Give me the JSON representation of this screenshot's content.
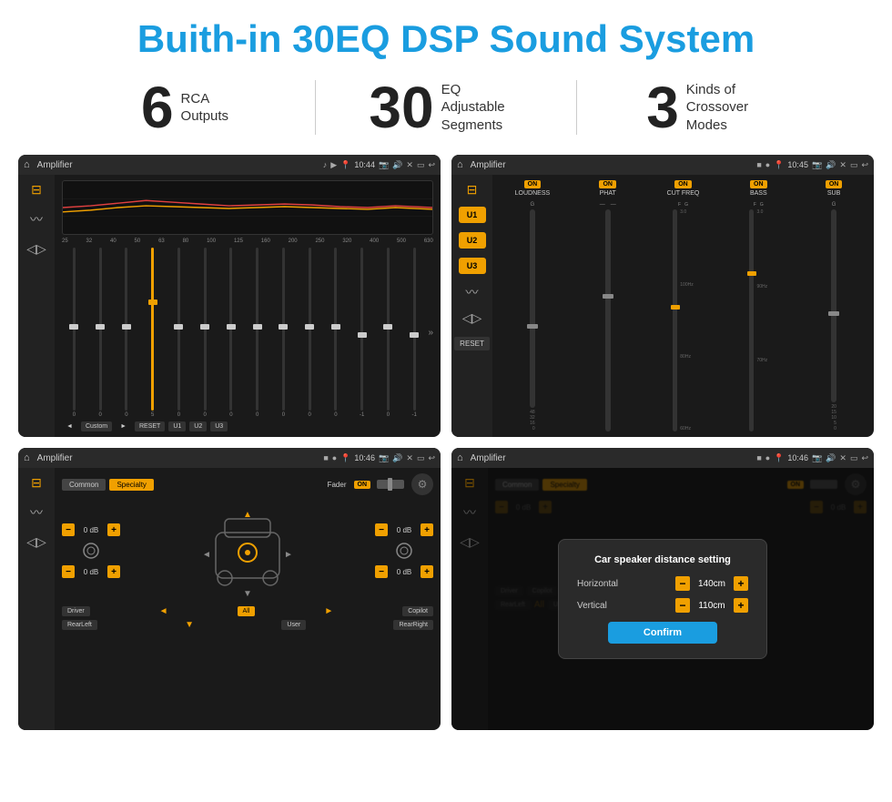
{
  "header": {
    "title": "Buith-in 30EQ DSP Sound System"
  },
  "stats": [
    {
      "number": "6",
      "text": "RCA\nOutputs"
    },
    {
      "number": "30",
      "text": "EQ Adjustable\nSegments"
    },
    {
      "number": "3",
      "text": "Kinds of\nCrossover Modes"
    }
  ],
  "screens": [
    {
      "name": "screen-eq",
      "topbar": {
        "title": "Amplifier",
        "time": "10:44"
      },
      "eq_labels": [
        "25",
        "32",
        "40",
        "50",
        "63",
        "80",
        "100",
        "125",
        "160",
        "200",
        "250",
        "320",
        "400",
        "500",
        "630"
      ],
      "eq_values": [
        "0",
        "0",
        "0",
        "5",
        "0",
        "0",
        "0",
        "0",
        "0",
        "0",
        "0",
        "-1",
        "0",
        "-1"
      ],
      "bottom_buttons": [
        "Custom",
        "RESET",
        "U1",
        "U2",
        "U3"
      ]
    },
    {
      "name": "screen-crossover",
      "topbar": {
        "title": "Amplifier",
        "time": "10:45"
      },
      "channels": [
        "LOUDNESS",
        "PHAT",
        "CUT FREQ",
        "BASS",
        "SUB"
      ],
      "u_buttons": [
        "U1",
        "U2",
        "U3"
      ]
    },
    {
      "name": "screen-fader",
      "topbar": {
        "title": "Amplifier",
        "time": "10:46"
      },
      "tabs": [
        "Common",
        "Specialty"
      ],
      "fader_label": "Fader",
      "on_label": "ON",
      "volumes": [
        "0 dB",
        "0 dB",
        "0 dB",
        "0 dB"
      ],
      "bottom_buttons": [
        "Driver",
        "Copilot",
        "RearLeft",
        "All",
        "User",
        "RearRight"
      ]
    },
    {
      "name": "screen-dialog",
      "topbar": {
        "title": "Amplifier",
        "time": "10:46"
      },
      "tabs": [
        "Common",
        "Specialty"
      ],
      "dialog": {
        "title": "Car speaker distance setting",
        "horizontal_label": "Horizontal",
        "horizontal_value": "140cm",
        "vertical_label": "Vertical",
        "vertical_value": "110cm",
        "confirm_label": "Confirm"
      },
      "volumes": [
        "0 dB",
        "0 dB"
      ],
      "bottom_buttons": [
        "Driver",
        "Copilot",
        "RearLeft",
        "All",
        "User",
        "RearRight"
      ]
    }
  ]
}
